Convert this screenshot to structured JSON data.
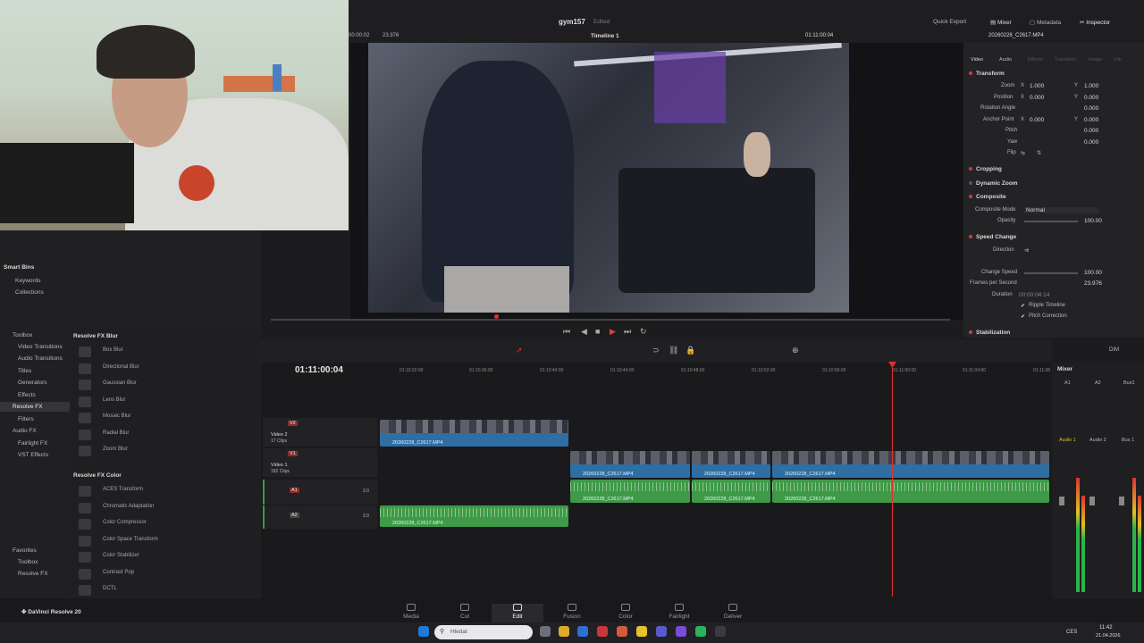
{
  "header": {
    "project_name": "gym157",
    "project_status": "Edited",
    "quick_export": "Quick Export",
    "mixer": "Mixer",
    "metadata": "Metadata",
    "inspector": "Inspector",
    "inspector_clip": "20260228_C2617.MP4",
    "timecode_left": "00:00:02",
    "fps": "23.976",
    "timeline_name": "Timeline 1",
    "viewer_timecode": "01:11:00:04"
  },
  "media_pool": {
    "smart_bins": "Smart Bins",
    "keywords": "Keywords",
    "collections": "Collections"
  },
  "effects_tree": {
    "items": [
      "Toolbox",
      "Video Transitions",
      "Audio Transitions",
      "Titles",
      "Generators",
      "Effects",
      "Resolve FX",
      "Filters",
      "Audio FX",
      "Fairlight FX",
      "VST Effects"
    ],
    "favorites": "Favorites",
    "fav_items": [
      "Toolbox",
      "Resolve FX"
    ]
  },
  "fx_list": {
    "group1": "Resolve FX Blur",
    "group1_items": [
      "Box Blur",
      "Directional Blur",
      "Gaussian Blur",
      "Lens Blur",
      "Mosaic Blur",
      "Radial Blur",
      "Zoom Blur"
    ],
    "group2": "Resolve FX Color",
    "group2_items": [
      "ACES Transform",
      "Chromatic Adaptation",
      "Color Compressor",
      "Color Space Transform",
      "Color Stabilizer",
      "Contrast Pop",
      "DCTL"
    ]
  },
  "inspector": {
    "tabs": [
      "Video",
      "Audio",
      "Effects",
      "Transition",
      "Image",
      "File"
    ],
    "transform": "Transform",
    "zoom_label": "Zoom",
    "zoom_x": "1.000",
    "zoom_y": "1.000",
    "position_label": "Position",
    "position_x": "0.000",
    "position_y": "0.000",
    "rotation_label": "Rotation Angle",
    "rotation_val": "0.000",
    "anchor_label": "Anchor Point",
    "anchor_x": "0.000",
    "anchor_y": "0.000",
    "pitch_label": "Pitch",
    "pitch_val": "0.000",
    "yaw_label": "Yaw",
    "yaw_val": "0.000",
    "flip_label": "Flip",
    "cropping": "Cropping",
    "dynamic_zoom": "Dynamic Zoom",
    "composite": "Composite",
    "composite_mode_label": "Composite Mode",
    "composite_mode": "Normal",
    "opacity_label": "Opacity",
    "opacity_val": "100.00",
    "speed_change": "Speed Change",
    "direction_label": "Direction",
    "change_speed_label": "Change Speed",
    "change_speed_val": "100.00",
    "fps_label": "Frames per Second",
    "fps_val": "23.976",
    "duration_label": "Duration",
    "duration_val": "00:00:04:14",
    "ripple": "Ripple Timeline",
    "pitch_correction": "Pitch Correction",
    "stabilization": "Stabilization"
  },
  "timeline": {
    "timecode": "01:11:00:04",
    "ruler": [
      "01:10:32:00",
      "01:10:36:00",
      "01:10:40:00",
      "01:10:44:00",
      "01:10:48:00",
      "01:10:52:00",
      "01:10:56:00",
      "01:11:00:00",
      "01:11:04:00",
      "01:11:08"
    ],
    "tracks": [
      {
        "id": "V2",
        "name": "Video 2",
        "clips": "17 Clips"
      },
      {
        "id": "V1",
        "name": "Video 1",
        "clips": "182 Clips"
      },
      {
        "id": "A1",
        "name": "",
        "level": "2.0"
      },
      {
        "id": "A2",
        "name": "",
        "level": "2.0"
      }
    ],
    "clip_name": "20260228_C2617.MP4"
  },
  "mixer": {
    "title": "Mixer",
    "channels": [
      "A1",
      "A2",
      "Bus1"
    ],
    "strips": [
      "Audio 1",
      "Audio 2",
      "Bus 1"
    ],
    "dim": "DIM"
  },
  "pages": [
    "Media",
    "Cut",
    "Edit",
    "Fusion",
    "Color",
    "Fairlight",
    "Deliver"
  ],
  "app_name": "DaVinci Resolve 20",
  "taskbar": {
    "search_placeholder": "Hledat",
    "lang": "CES",
    "time": "11:42",
    "date": "21.04.2026"
  }
}
